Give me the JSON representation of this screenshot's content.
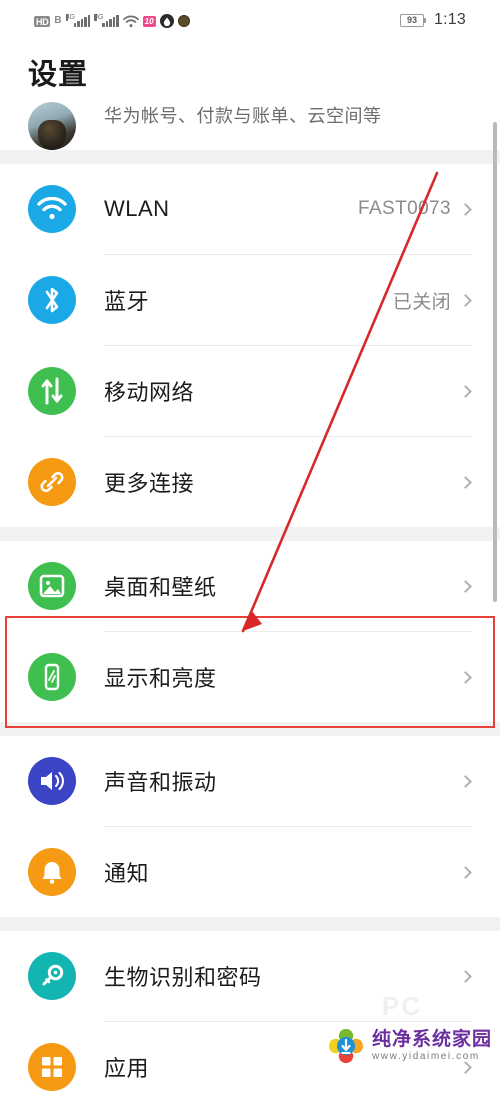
{
  "status_bar": {
    "hd_label": "HD",
    "sim_label": "B",
    "net1_label": "4G",
    "net2_label": "4G",
    "wifi_icon": "wifi-icon",
    "pink_badge_label": "10",
    "app_icon_1": "water-drop-circle-icon",
    "app_icon_2": "dark-round-icon",
    "battery_level": "93",
    "time": "1:13"
  },
  "header": {
    "title": "设置"
  },
  "account_row": {
    "icon": "user-avatar",
    "label": "华为帐号、付款与账单、云空间等"
  },
  "groups": [
    {
      "name": "connectivity",
      "items": [
        {
          "icon": "wlan-icon",
          "icon_color": "#1aa9e6",
          "label": "WLAN",
          "value": "FAST0073"
        },
        {
          "icon": "bluetooth-icon",
          "icon_color": "#1aa9e6",
          "label": "蓝牙",
          "value": "已关闭"
        },
        {
          "icon": "mobile-network-icon",
          "icon_color": "#3fbf4f",
          "label": "移动网络",
          "value": ""
        },
        {
          "icon": "more-connections-icon",
          "icon_color": "#f59a12",
          "label": "更多连接",
          "value": ""
        }
      ]
    },
    {
      "name": "home-and-wallpaper",
      "items": [
        {
          "icon": "wallpaper-icon",
          "icon_color": "#3fbf4f",
          "label": "桌面和壁纸",
          "value": ""
        }
      ]
    },
    {
      "name": "display",
      "highlighted": true,
      "items": [
        {
          "icon": "display-brightness-icon",
          "icon_color": "#3fbf4f",
          "label": "显示和亮度",
          "value": ""
        }
      ]
    },
    {
      "name": "sound-and-notifications",
      "items": [
        {
          "icon": "sound-vibration-icon",
          "icon_color": "#3b44c4",
          "label": "声音和振动",
          "value": ""
        },
        {
          "icon": "notification-bell-icon",
          "icon_color": "#f59a12",
          "label": "通知",
          "value": ""
        }
      ]
    },
    {
      "name": "security-and-apps",
      "items": [
        {
          "icon": "biometrics-password-icon",
          "icon_color": "#13b5b1",
          "label": "生物识别和密码",
          "value": ""
        },
        {
          "icon": "apps-grid-icon",
          "icon_color": "#f59a12",
          "label": "应用",
          "value": ""
        }
      ]
    }
  ],
  "annotation": {
    "arrow_color": "#d8282a",
    "box_color": "#e8413a",
    "target_label": "显示和亮度"
  },
  "watermark": {
    "site_name": "纯净系统家园",
    "site_url": "www.yidaimei.com",
    "ghost_text": "PC"
  },
  "colors": {
    "page_bg": "#f2f2f2",
    "card_bg": "#ffffff",
    "label_text": "#1c1c1c",
    "value_text": "#8c8c8c",
    "divider": "#ececec"
  }
}
